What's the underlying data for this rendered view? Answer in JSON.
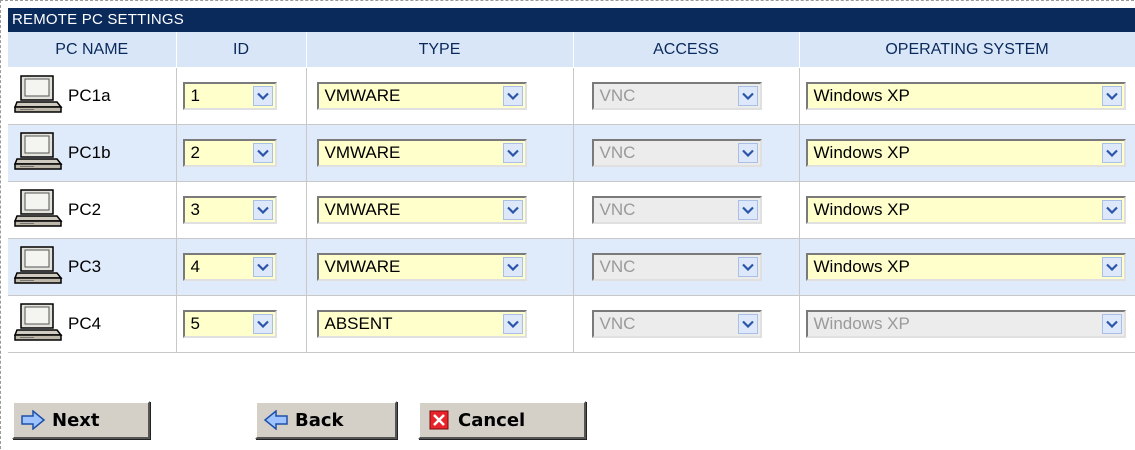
{
  "panel": {
    "title": "REMOTE PC SETTINGS"
  },
  "columns": {
    "pc_name": "PC NAME",
    "id": "ID",
    "type": "TYPE",
    "access": "ACCESS",
    "os": "OPERATING SYSTEM"
  },
  "rows": [
    {
      "name": "PC1a",
      "id": "1",
      "type": "VMWARE",
      "access": "VNC",
      "os": "Windows XP",
      "os_disabled": false
    },
    {
      "name": "PC1b",
      "id": "2",
      "type": "VMWARE",
      "access": "VNC",
      "os": "Windows XP",
      "os_disabled": false
    },
    {
      "name": "PC2",
      "id": "3",
      "type": "VMWARE",
      "access": "VNC",
      "os": "Windows XP",
      "os_disabled": false
    },
    {
      "name": "PC3",
      "id": "4",
      "type": "VMWARE",
      "access": "VNC",
      "os": "Windows XP",
      "os_disabled": false
    },
    {
      "name": "PC4",
      "id": "5",
      "type": "ABSENT",
      "access": "VNC",
      "os": "Windows XP",
      "os_disabled": true
    }
  ],
  "buttons": {
    "next": "Next",
    "back": "Back",
    "cancel": "Cancel"
  },
  "icons": {
    "row": "computer-icon",
    "next": "arrow-right-icon",
    "back": "arrow-left-icon",
    "cancel": "close-icon"
  },
  "colors": {
    "title_bar": "#0a2a5c",
    "header_bg": "#d8e6f7",
    "alt_row": "#dfeafb",
    "select_bg": "#ffffcc"
  }
}
